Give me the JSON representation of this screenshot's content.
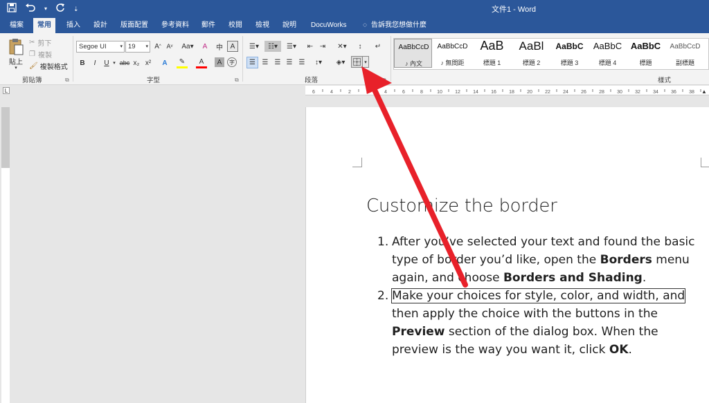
{
  "titlebar": {
    "title": "文件1 - Word",
    "save_icon": "save-icon",
    "undo_icon": "undo-icon",
    "redo_icon": "redo-icon"
  },
  "tabs": [
    "檔案",
    "常用",
    "插入",
    "設計",
    "版面配置",
    "參考資料",
    "郵件",
    "校閱",
    "檢視",
    "說明",
    "DocuWorks",
    "告訴我您想做什麼"
  ],
  "clipboard": {
    "paste": "貼上",
    "cut": "剪下",
    "copy": "複製",
    "format_painter": "複製格式",
    "label": "剪貼簿"
  },
  "font": {
    "family": "Segoe UI",
    "size": "19",
    "label": "字型",
    "buttons": [
      "B",
      "I",
      "U",
      "abc",
      "x₂",
      "x²",
      "A",
      "A",
      "A"
    ]
  },
  "paragraph": {
    "label": "段落"
  },
  "styles": {
    "label": "樣式",
    "items": [
      {
        "sample": "AaBbCcD",
        "name": "♪ 內文"
      },
      {
        "sample": "AaBbCcD",
        "name": "♪ 無間距"
      },
      {
        "sample": "AaB",
        "name": "標題 1"
      },
      {
        "sample": "AaBl",
        "name": "標題 2"
      },
      {
        "sample": "AaBbC",
        "name": "標題 3"
      },
      {
        "sample": "AaBbC",
        "name": "標題 4"
      },
      {
        "sample": "AaBbC",
        "name": "標題"
      },
      {
        "sample": "AaBbCcD",
        "name": "副標題"
      }
    ]
  },
  "document": {
    "heading": "Customize the border",
    "items": [
      {
        "num": "1.",
        "parts": [
          {
            "t": "After you’ve selected your text and found the basic type of border you’d like, open the ",
            "b": false
          },
          {
            "t": "Borders",
            "b": true
          },
          {
            "t": " menu again, and choose ",
            "b": false
          },
          {
            "t": "Borders and Shading",
            "b": true
          },
          {
            "t": ".",
            "b": false
          }
        ]
      },
      {
        "num": "2.",
        "boxed_line": "Make your choices for style, color, and width, and",
        "parts": [
          {
            "t": " then apply the choice with the buttons in the ",
            "b": false
          },
          {
            "t": "Preview",
            "b": true
          },
          {
            "t": " section of the dialog box. When the preview is the way you want it, click ",
            "b": false
          },
          {
            "t": "OK",
            "b": true
          },
          {
            "t": ".",
            "b": false
          }
        ]
      }
    ]
  },
  "ruler_numbers": [
    "6",
    "4",
    "2",
    "2",
    "4",
    "6",
    "8",
    "10",
    "12",
    "14",
    "16",
    "18",
    "20",
    "22",
    "24",
    "26",
    "28",
    "30",
    "32",
    "34",
    "36",
    "38"
  ],
  "colors": {
    "brand": "#2b579a",
    "arrow": "#e8212a",
    "highlight": "#ffff00",
    "font_color": "#ff0000"
  }
}
